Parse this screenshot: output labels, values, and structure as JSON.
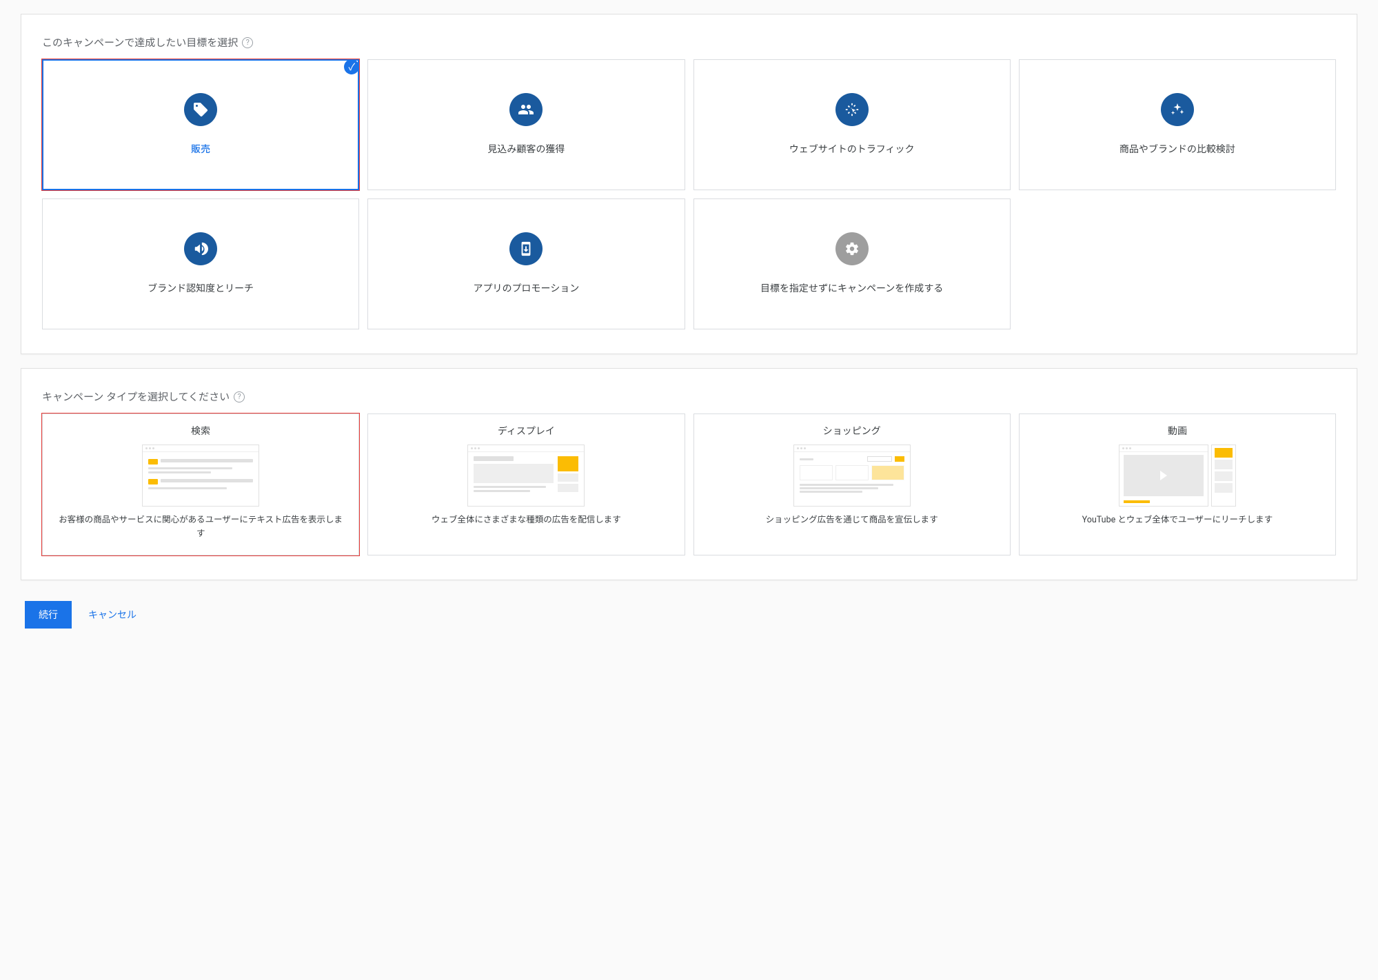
{
  "goal_section": {
    "title": "このキャンペーンで達成したい目標を選択",
    "cards": [
      {
        "label": "販売",
        "icon": "tag-icon",
        "selected": true
      },
      {
        "label": "見込み顧客の獲得",
        "icon": "people-icon",
        "selected": false
      },
      {
        "label": "ウェブサイトのトラフィック",
        "icon": "cursor-icon",
        "selected": false
      },
      {
        "label": "商品やブランドの比較検討",
        "icon": "sparkle-icon",
        "selected": false
      },
      {
        "label": "ブランド認知度とリーチ",
        "icon": "megaphone-icon",
        "selected": false
      },
      {
        "label": "アプリのプロモーション",
        "icon": "app-download-icon",
        "selected": false
      },
      {
        "label": "目標を指定せずにキャンペーンを作成する",
        "icon": "gear-icon",
        "selected": false,
        "muted": true
      }
    ]
  },
  "type_section": {
    "title": "キャンペーン タイプを選択してください",
    "cards": [
      {
        "title": "検索",
        "desc": "お客様の商品やサービスに関心があるユーザーにテキスト広告を表示します",
        "highlight": true
      },
      {
        "title": "ディスプレイ",
        "desc": "ウェブ全体にさまざまな種類の広告を配信します",
        "highlight": false
      },
      {
        "title": "ショッピング",
        "desc": "ショッピング広告を通じて商品を宣伝します",
        "highlight": false
      },
      {
        "title": "動画",
        "desc": "YouTube とウェブ全体でユーザーにリーチします",
        "highlight": false
      }
    ]
  },
  "buttons": {
    "continue": "続行",
    "cancel": "キャンセル"
  }
}
